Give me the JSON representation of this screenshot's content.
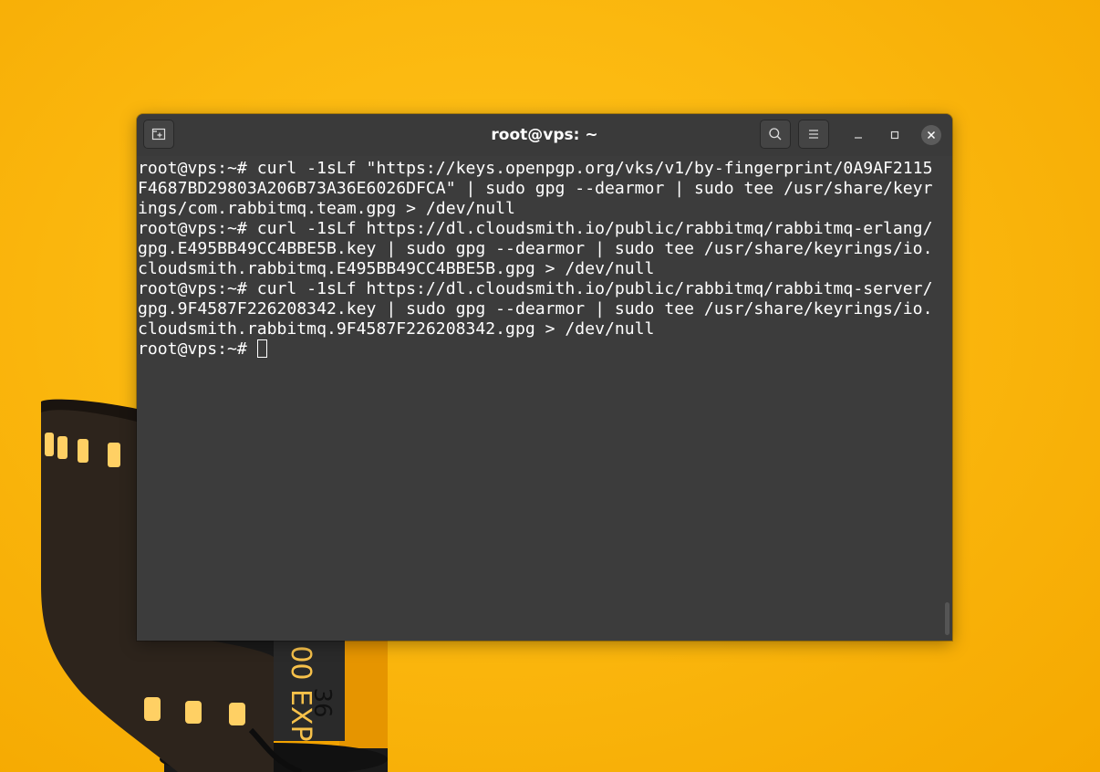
{
  "window": {
    "title": "root@vps: ~"
  },
  "headerbar": {
    "new_tab_icon": "new-tab-icon",
    "search_icon": "search-icon",
    "menu_icon": "hamburger-menu-icon",
    "minimize_icon": "minimize-icon",
    "maximize_icon": "maximize-icon",
    "close_icon": "close-icon"
  },
  "terminal": {
    "lines": [
      "root@vps:~# curl -1sLf \"https://keys.openpgp.org/vks/v1/by-fingerprint/0A9AF2115",
      "F4687BD29803A206B73A36E6026DFCA\" | sudo gpg --dearmor | sudo tee /usr/share/keyr",
      "ings/com.rabbitmq.team.gpg > /dev/null",
      "root@vps:~# curl -1sLf https://dl.cloudsmith.io/public/rabbitmq/rabbitmq-erlang/",
      "gpg.E495BB49CC4BBE5B.key | sudo gpg --dearmor | sudo tee /usr/share/keyrings/io.",
      "cloudsmith.rabbitmq.E495BB49CC4BBE5B.gpg > /dev/null",
      "root@vps:~# curl -1sLf https://dl.cloudsmith.io/public/rabbitmq/rabbitmq-server/",
      "gpg.9F4587F226208342.key | sudo gpg --dearmor | sudo tee /usr/share/keyrings/io.",
      "cloudsmith.rabbitmq.9F4587F226208342.gpg > /dev/null"
    ],
    "prompt": "root@vps:~# "
  },
  "wallpaper": {
    "film_text_1": "36",
    "film_text_2": "00 EXP"
  },
  "colors": {
    "background": "#fbb80f",
    "terminal_bg": "#3c3c3c",
    "terminal_fg": "#ffffff"
  }
}
